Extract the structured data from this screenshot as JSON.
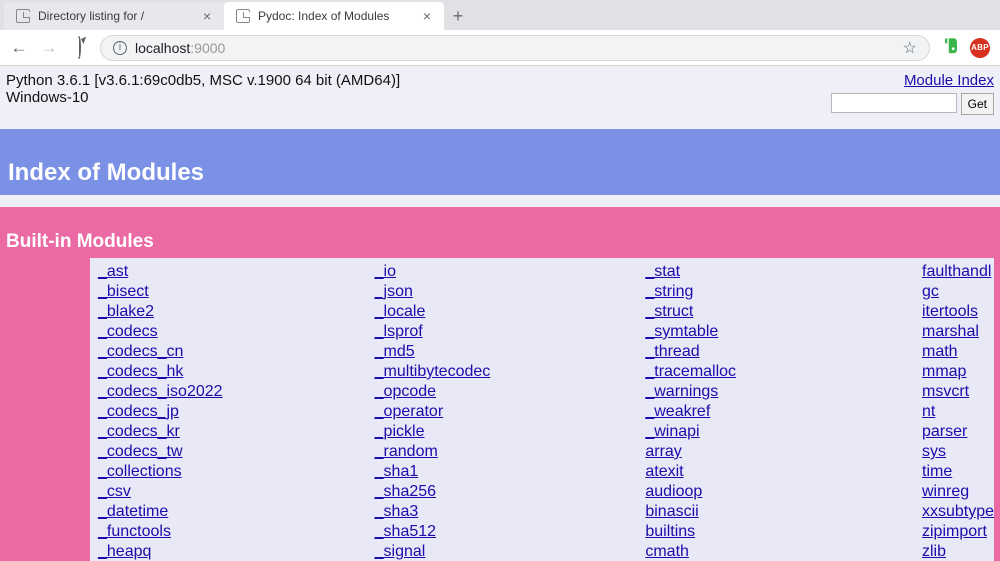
{
  "browser": {
    "tabs": [
      {
        "title": "Directory listing for /",
        "active": false
      },
      {
        "title": "Pydoc: Index of Modules",
        "active": true
      }
    ],
    "url_host": "localhost",
    "url_port": ":9000",
    "info_icon_glyph": "i",
    "abp_label": "ABP"
  },
  "page": {
    "python_line": "Python 3.6.1 [v3.6.1:69c0db5, MSC v.1900 64 bit (AMD64)]",
    "os_line": "Windows-10",
    "module_index_link": "Module Index",
    "get_button": "Get",
    "title": "Index of Modules",
    "section_title": "Built-in Modules",
    "columns": [
      [
        "_ast",
        "_bisect",
        "_blake2",
        "_codecs",
        "_codecs_cn",
        "_codecs_hk",
        "_codecs_iso2022",
        "_codecs_jp",
        "_codecs_kr",
        "_codecs_tw",
        "_collections",
        "_csv",
        "_datetime",
        "_functools",
        "_heapq"
      ],
      [
        "_io",
        "_json",
        "_locale",
        "_lsprof",
        "_md5",
        "_multibytecodec",
        "_opcode",
        "_operator",
        "_pickle",
        "_random",
        "_sha1",
        "_sha256",
        "_sha3",
        "_sha512",
        "_signal"
      ],
      [
        "_stat",
        "_string",
        "_struct",
        "_symtable",
        "_thread",
        "_tracemalloc",
        "_warnings",
        "_weakref",
        "_winapi",
        "array",
        "atexit",
        "audioop",
        "binascii",
        "builtins",
        "cmath"
      ],
      [
        "faulthandl",
        "gc",
        "itertools",
        "marshal",
        "math",
        "mmap",
        "msvcrt",
        "nt",
        "parser",
        "sys",
        "time",
        "winreg",
        "xxsubtype",
        "zipimport",
        "zlib"
      ]
    ]
  }
}
